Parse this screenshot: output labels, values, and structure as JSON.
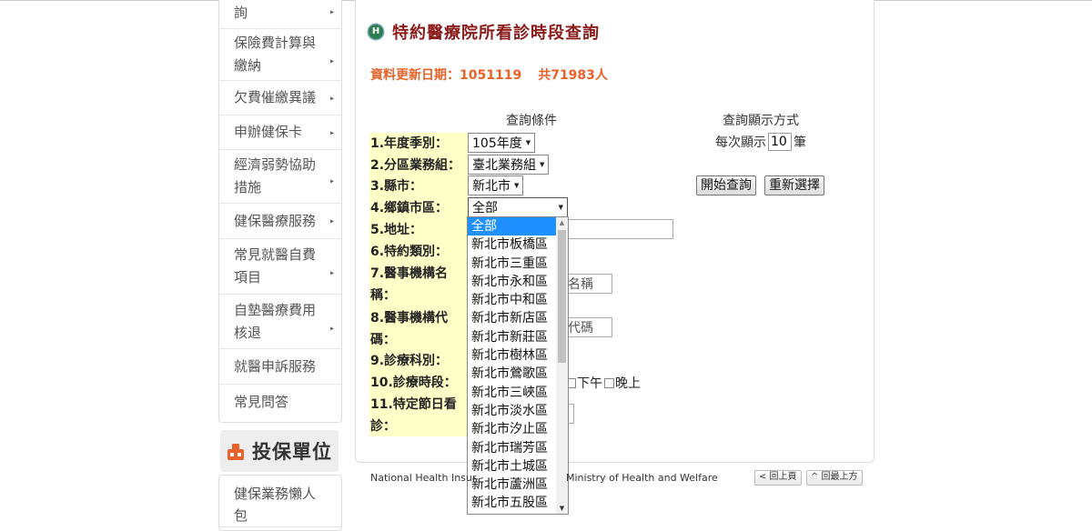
{
  "sidebar": {
    "items": [
      {
        "label": "詢"
      },
      {
        "label": "保險費計算與繳納"
      },
      {
        "label": "欠費催繳異議"
      },
      {
        "label": "申辦健保卡"
      },
      {
        "label": "經濟弱勢協助措施"
      },
      {
        "label": "健保醫療服務"
      },
      {
        "label": "常見就醫自費項目"
      },
      {
        "label": "自墊醫療費用核退"
      },
      {
        "label": "就醫申訴服務"
      },
      {
        "label": "常見問答"
      }
    ],
    "arrow": "▸",
    "section_title": "投保單位",
    "section_items": [
      {
        "label": "健保業務懶人包"
      }
    ]
  },
  "page": {
    "logo_letter": "H",
    "title": "特約醫療院所看診時段查詢",
    "update_date": "資料更新日期：1051119",
    "update_count": "共71983人"
  },
  "form": {
    "conditions_header": "查詢條件",
    "display_header": "查詢顯示方式",
    "per_page_prefix": "每次顯示",
    "per_page_value": "10",
    "per_page_suffix": "筆",
    "search_button": "開始查詢",
    "reset_button": "重新選擇",
    "labels": [
      "1.年度季別：",
      "2.分區業務組：",
      "3.縣市：",
      "4.鄉鎮市區：",
      "5.地址：",
      "6.特約類別：",
      "7.醫事機構名稱：",
      "8.醫事機構代碼：",
      "9.診療科別：",
      "10.診療時段：",
      "11.特定節日看診："
    ],
    "year_value": "105年度",
    "branch_value": "臺北業務組",
    "city_value": "新北市",
    "district_value": "全部",
    "name_placeholder_tail": "名稱",
    "code_placeholder_tail": "代碼",
    "time_options": [
      "下午",
      "晚上"
    ]
  },
  "dropdown": {
    "options": [
      "全部",
      "新北市板橋區",
      "新北市三重區",
      "新北市永和區",
      "新北市中和區",
      "新北市新店區",
      "新北市新莊區",
      "新北市樹林區",
      "新北市鶯歌區",
      "新北市三峽區",
      "新北市淡水區",
      "新北市汐止區",
      "新北市瑞芳區",
      "新北市土城區",
      "新北市蘆洲區",
      "新北市五股區"
    ],
    "selected_index": 0
  },
  "footer": {
    "left": "National Health Insur",
    "right": "Ministry of Health and Welfare",
    "prev_page": "< 回上頁",
    "top": "^ 回最上方"
  },
  "colors": {
    "title": "#8b1a1a",
    "update": "#e8622a",
    "label_bg": "#ffffc8",
    "selected": "#1e90ff"
  }
}
